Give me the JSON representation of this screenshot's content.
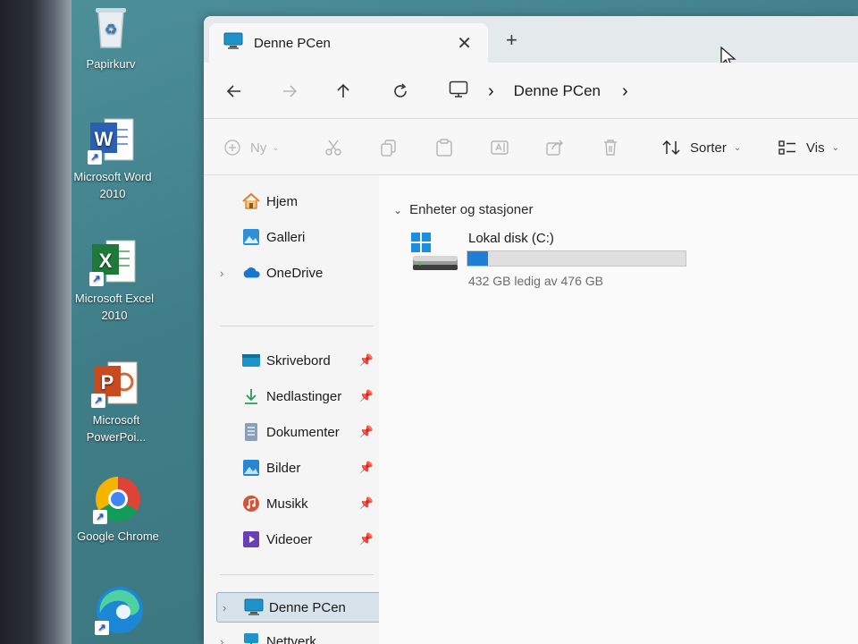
{
  "desktop": {
    "icons": [
      {
        "label": "Papirkurv",
        "icon": "recycle-bin-icon"
      },
      {
        "label": "Microsoft Word 2010",
        "icon": "word-icon"
      },
      {
        "label": "Microsoft Excel 2010",
        "icon": "excel-icon"
      },
      {
        "label": "Microsoft PowerPoi...",
        "icon": "powerpoint-icon"
      },
      {
        "label": "Google Chrome",
        "icon": "chrome-icon"
      },
      {
        "label": "",
        "icon": "edge-icon"
      }
    ]
  },
  "window": {
    "tab": {
      "title": "Denne PCen",
      "close": "✕"
    },
    "new_tab": "+",
    "breadcrumb": {
      "location": "Denne PCen",
      "separator": "›"
    },
    "toolbar": {
      "new_label": "Ny",
      "sort_label": "Sorter",
      "view_label": "Vis"
    },
    "sidebar": {
      "top": [
        {
          "label": "Hjem",
          "icon": "home-icon"
        },
        {
          "label": "Galleri",
          "icon": "gallery-icon"
        },
        {
          "label": "OneDrive",
          "icon": "cloud-icon"
        }
      ],
      "pinned": [
        {
          "label": "Skrivebord",
          "icon": "desktop-folder-icon"
        },
        {
          "label": "Nedlastinger",
          "icon": "download-icon"
        },
        {
          "label": "Dokumenter",
          "icon": "document-icon"
        },
        {
          "label": "Bilder",
          "icon": "image-icon"
        },
        {
          "label": "Musikk",
          "icon": "music-icon"
        },
        {
          "label": "Videoer",
          "icon": "video-icon"
        }
      ],
      "bottom": [
        {
          "label": "Denne PCen",
          "icon": "pc-icon"
        },
        {
          "label": "Nettverk",
          "icon": "network-icon"
        }
      ]
    },
    "content": {
      "group_header": "Enheter og stasjoner",
      "drive": {
        "name": "Lokal disk (C:)",
        "free_text": "432 GB ledig av 476 GB",
        "used_fraction": 0.0924
      }
    }
  },
  "colors": {
    "accent": "#1f7fd6",
    "desktop": "#3f7e88"
  }
}
